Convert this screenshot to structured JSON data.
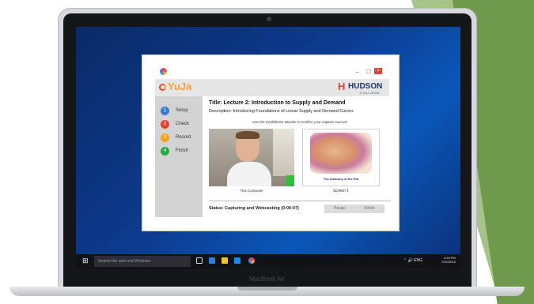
{
  "device": {
    "brand": "MacBook Air"
  },
  "window": {
    "controls": "– ☐",
    "close_glyph": "×"
  },
  "header": {
    "app_logo": "YuJa",
    "institution_name": "HUDSON",
    "institution_sub": "COLLEGE"
  },
  "steps": [
    {
      "number": "1",
      "label": "Setup",
      "color": "#3a7bd5"
    },
    {
      "number": "2",
      "label": "Check",
      "color": "#e0463a"
    },
    {
      "number": "3",
      "label": "Record",
      "color": "#f2a41b"
    },
    {
      "number": "4",
      "label": "Finish",
      "color": "#2aa84a"
    }
  ],
  "lecture": {
    "title": "Title: Lecture 2: Introduction to Supply and Demand",
    "description": "Description: Introducing Foundations of Linear Supply and Demand Curves"
  },
  "instruction": "Use the Confidence Monitor to confirm your capture sources",
  "sources": {
    "camera_label": "This Computer",
    "screen_label": "Screen 1",
    "screen_caption": "The Anatomy of the Ear"
  },
  "status": "Status: Capturing and Webcasting (0:00:07)",
  "buttons": {
    "pause": "Pause",
    "finish": "Finish"
  },
  "taskbar": {
    "search_placeholder": "Search the web and Windows",
    "tray": "⌃ 🔊 ENG",
    "time": "4:39 PM",
    "date": "7/22/2015"
  }
}
